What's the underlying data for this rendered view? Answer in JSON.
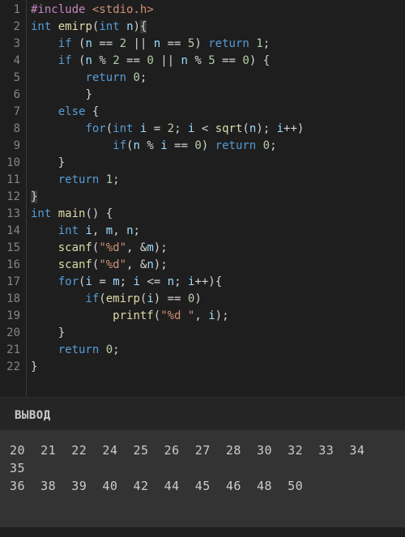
{
  "code": {
    "lines": [
      {
        "n": 1,
        "tokens": [
          [
            "tk-pp",
            "#include "
          ],
          [
            "tk-inc",
            "<stdio.h>"
          ]
        ]
      },
      {
        "n": 2,
        "tokens": [
          [
            "tk-kw",
            "int"
          ],
          [
            "tk-op",
            " "
          ],
          [
            "tk-fn",
            "emirp"
          ],
          [
            "tk-pun",
            "("
          ],
          [
            "tk-kw",
            "int"
          ],
          [
            "tk-op",
            " "
          ],
          [
            "tk-id",
            "n"
          ],
          [
            "tk-pun",
            ")"
          ],
          [
            "tk-pun tk-brace-hl",
            "{"
          ]
        ]
      },
      {
        "n": 3,
        "tokens": [
          [
            "tk-op",
            "    "
          ],
          [
            "tk-kw",
            "if"
          ],
          [
            "tk-op",
            " "
          ],
          [
            "tk-pun",
            "("
          ],
          [
            "tk-id",
            "n"
          ],
          [
            "tk-op",
            " == "
          ],
          [
            "tk-num",
            "2"
          ],
          [
            "tk-op",
            " || "
          ],
          [
            "tk-id",
            "n"
          ],
          [
            "tk-op",
            " == "
          ],
          [
            "tk-num",
            "5"
          ],
          [
            "tk-pun",
            ")"
          ],
          [
            "tk-op",
            " "
          ],
          [
            "tk-kw",
            "return"
          ],
          [
            "tk-op",
            " "
          ],
          [
            "tk-num",
            "1"
          ],
          [
            "tk-pun",
            ";"
          ]
        ]
      },
      {
        "n": 4,
        "tokens": [
          [
            "tk-op",
            "    "
          ],
          [
            "tk-kw",
            "if"
          ],
          [
            "tk-op",
            " "
          ],
          [
            "tk-pun",
            "("
          ],
          [
            "tk-id",
            "n"
          ],
          [
            "tk-op",
            " % "
          ],
          [
            "tk-num",
            "2"
          ],
          [
            "tk-op",
            " == "
          ],
          [
            "tk-num",
            "0"
          ],
          [
            "tk-op",
            " || "
          ],
          [
            "tk-id",
            "n"
          ],
          [
            "tk-op",
            " % "
          ],
          [
            "tk-num",
            "5"
          ],
          [
            "tk-op",
            " == "
          ],
          [
            "tk-num",
            "0"
          ],
          [
            "tk-pun",
            ")"
          ],
          [
            "tk-op",
            " "
          ],
          [
            "tk-pun",
            "{"
          ]
        ]
      },
      {
        "n": 5,
        "tokens": [
          [
            "tk-op",
            "        "
          ],
          [
            "tk-kw",
            "return"
          ],
          [
            "tk-op",
            " "
          ],
          [
            "tk-num",
            "0"
          ],
          [
            "tk-pun",
            ";"
          ]
        ]
      },
      {
        "n": 6,
        "tokens": [
          [
            "tk-op",
            "        "
          ],
          [
            "tk-pun",
            "}"
          ]
        ]
      },
      {
        "n": 7,
        "tokens": [
          [
            "tk-op",
            "    "
          ],
          [
            "tk-kw",
            "else"
          ],
          [
            "tk-op",
            " "
          ],
          [
            "tk-pun",
            "{"
          ]
        ]
      },
      {
        "n": 8,
        "tokens": [
          [
            "tk-op",
            "        "
          ],
          [
            "tk-kw",
            "for"
          ],
          [
            "tk-pun",
            "("
          ],
          [
            "tk-kw",
            "int"
          ],
          [
            "tk-op",
            " "
          ],
          [
            "tk-id",
            "i"
          ],
          [
            "tk-op",
            " = "
          ],
          [
            "tk-num",
            "2"
          ],
          [
            "tk-pun",
            ";"
          ],
          [
            "tk-op",
            " "
          ],
          [
            "tk-id",
            "i"
          ],
          [
            "tk-op",
            " < "
          ],
          [
            "tk-fn",
            "sqrt"
          ],
          [
            "tk-pun",
            "("
          ],
          [
            "tk-id",
            "n"
          ],
          [
            "tk-pun",
            ")"
          ],
          [
            "tk-pun",
            ";"
          ],
          [
            "tk-op",
            " "
          ],
          [
            "tk-id",
            "i"
          ],
          [
            "tk-op",
            "++"
          ],
          [
            "tk-pun",
            ")"
          ]
        ]
      },
      {
        "n": 9,
        "tokens": [
          [
            "tk-op",
            "            "
          ],
          [
            "tk-kw",
            "if"
          ],
          [
            "tk-pun",
            "("
          ],
          [
            "tk-id",
            "n"
          ],
          [
            "tk-op",
            " % "
          ],
          [
            "tk-id",
            "i"
          ],
          [
            "tk-op",
            " == "
          ],
          [
            "tk-num",
            "0"
          ],
          [
            "tk-pun",
            ")"
          ],
          [
            "tk-op",
            " "
          ],
          [
            "tk-kw",
            "return"
          ],
          [
            "tk-op",
            " "
          ],
          [
            "tk-num",
            "0"
          ],
          [
            "tk-pun",
            ";"
          ]
        ]
      },
      {
        "n": 10,
        "tokens": [
          [
            "tk-op",
            "    "
          ],
          [
            "tk-pun",
            "}"
          ]
        ]
      },
      {
        "n": 11,
        "tokens": [
          [
            "tk-op",
            "    "
          ],
          [
            "tk-kw",
            "return"
          ],
          [
            "tk-op",
            " "
          ],
          [
            "tk-num",
            "1"
          ],
          [
            "tk-pun",
            ";"
          ]
        ]
      },
      {
        "n": 12,
        "tokens": [
          [
            "tk-pun tk-brace-hl",
            "}"
          ]
        ]
      },
      {
        "n": 13,
        "tokens": [
          [
            "tk-kw",
            "int"
          ],
          [
            "tk-op",
            " "
          ],
          [
            "tk-fn",
            "main"
          ],
          [
            "tk-pun",
            "()"
          ],
          [
            "tk-op",
            " "
          ],
          [
            "tk-pun",
            "{"
          ]
        ]
      },
      {
        "n": 14,
        "tokens": [
          [
            "tk-op",
            "    "
          ],
          [
            "tk-kw",
            "int"
          ],
          [
            "tk-op",
            " "
          ],
          [
            "tk-id",
            "i"
          ],
          [
            "tk-pun",
            ","
          ],
          [
            "tk-op",
            " "
          ],
          [
            "tk-id",
            "m"
          ],
          [
            "tk-pun",
            ","
          ],
          [
            "tk-op",
            " "
          ],
          [
            "tk-id",
            "n"
          ],
          [
            "tk-pun",
            ";"
          ]
        ]
      },
      {
        "n": 15,
        "tokens": [
          [
            "tk-op",
            "    "
          ],
          [
            "tk-fn",
            "scanf"
          ],
          [
            "tk-pun",
            "("
          ],
          [
            "tk-str",
            "\"%d\""
          ],
          [
            "tk-pun",
            ","
          ],
          [
            "tk-op",
            " &"
          ],
          [
            "tk-id",
            "m"
          ],
          [
            "tk-pun",
            ")"
          ],
          [
            "tk-pun",
            ";"
          ]
        ]
      },
      {
        "n": 16,
        "tokens": [
          [
            "tk-op",
            "    "
          ],
          [
            "tk-fn",
            "scanf"
          ],
          [
            "tk-pun",
            "("
          ],
          [
            "tk-str",
            "\"%d\""
          ],
          [
            "tk-pun",
            ","
          ],
          [
            "tk-op",
            " &"
          ],
          [
            "tk-id",
            "n"
          ],
          [
            "tk-pun",
            ")"
          ],
          [
            "tk-pun",
            ";"
          ]
        ]
      },
      {
        "n": 17,
        "tokens": [
          [
            "tk-op",
            "    "
          ],
          [
            "tk-kw",
            "for"
          ],
          [
            "tk-pun",
            "("
          ],
          [
            "tk-id",
            "i"
          ],
          [
            "tk-op",
            " = "
          ],
          [
            "tk-id",
            "m"
          ],
          [
            "tk-pun",
            ";"
          ],
          [
            "tk-op",
            " "
          ],
          [
            "tk-id",
            "i"
          ],
          [
            "tk-op",
            " <= "
          ],
          [
            "tk-id",
            "n"
          ],
          [
            "tk-pun",
            ";"
          ],
          [
            "tk-op",
            " "
          ],
          [
            "tk-id",
            "i"
          ],
          [
            "tk-op",
            "++"
          ],
          [
            "tk-pun",
            ")"
          ],
          [
            "tk-pun",
            "{"
          ]
        ]
      },
      {
        "n": 18,
        "tokens": [
          [
            "tk-op",
            "        "
          ],
          [
            "tk-kw",
            "if"
          ],
          [
            "tk-pun",
            "("
          ],
          [
            "tk-fn",
            "emirp"
          ],
          [
            "tk-pun",
            "("
          ],
          [
            "tk-id",
            "i"
          ],
          [
            "tk-pun",
            ")"
          ],
          [
            "tk-op",
            " == "
          ],
          [
            "tk-num",
            "0"
          ],
          [
            "tk-pun",
            ")"
          ]
        ]
      },
      {
        "n": 19,
        "tokens": [
          [
            "tk-op",
            "            "
          ],
          [
            "tk-fn",
            "printf"
          ],
          [
            "tk-pun",
            "("
          ],
          [
            "tk-str",
            "\"%d \""
          ],
          [
            "tk-pun",
            ","
          ],
          [
            "tk-op",
            " "
          ],
          [
            "tk-id",
            "i"
          ],
          [
            "tk-pun",
            ")"
          ],
          [
            "tk-pun",
            ";"
          ]
        ]
      },
      {
        "n": 20,
        "tokens": [
          [
            "tk-op",
            "    "
          ],
          [
            "tk-pun",
            "}"
          ]
        ]
      },
      {
        "n": 21,
        "tokens": [
          [
            "tk-op",
            "    "
          ],
          [
            "tk-kw",
            "return"
          ],
          [
            "tk-op",
            " "
          ],
          [
            "tk-num",
            "0"
          ],
          [
            "tk-pun",
            ";"
          ]
        ]
      },
      {
        "n": 22,
        "tokens": [
          [
            "tk-pun",
            "}"
          ]
        ]
      }
    ]
  },
  "output": {
    "header": "ВЫВОД",
    "lines": [
      "20  21  22  24  25  26  27  28  30  32  33  34  35  ",
      "36  38  39  40  42  44  45  46  48  50  "
    ]
  }
}
